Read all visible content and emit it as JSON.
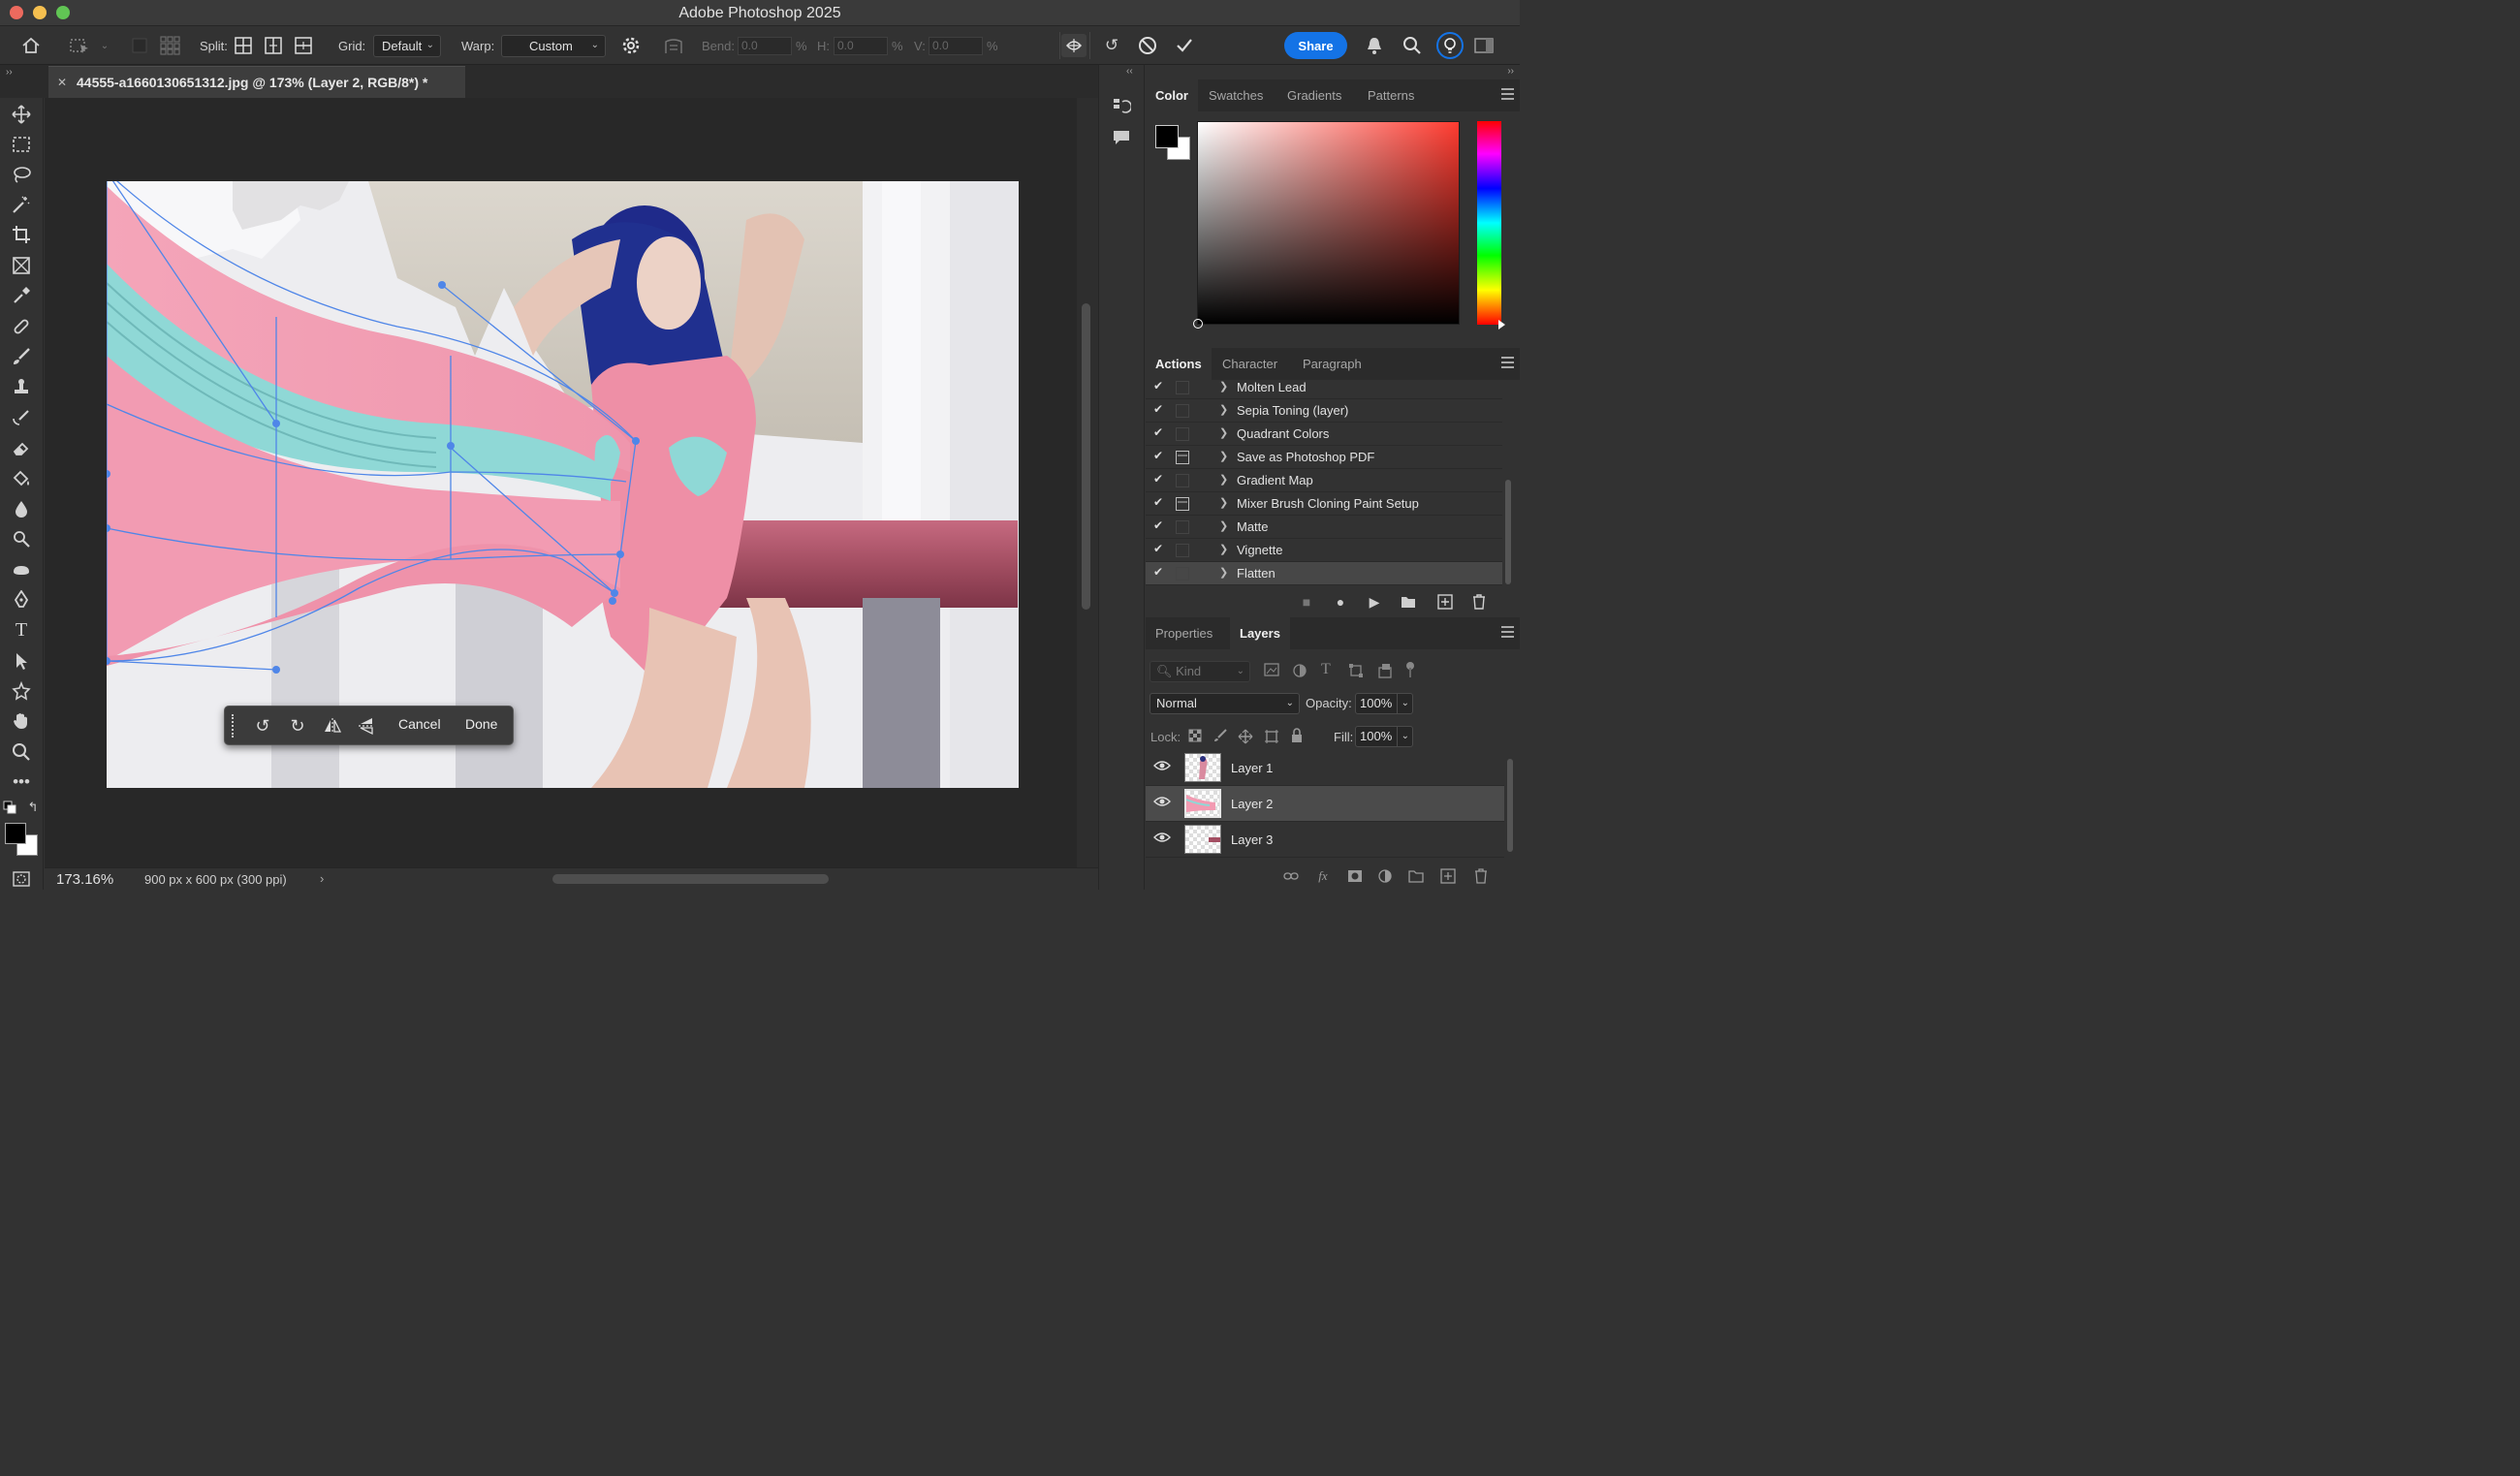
{
  "app": {
    "title": "Adobe Photoshop 2025"
  },
  "options_bar": {
    "split_label": "Split:",
    "grid_label": "Grid:",
    "grid_value": "Default",
    "warp_label": "Warp:",
    "warp_value": "Custom",
    "bend_label": "Bend:",
    "bend_value": "0.0",
    "h_label": "H:",
    "h_value": "0.0",
    "v_label": "V:",
    "v_value": "0.0",
    "percent": "%",
    "share_label": "Share"
  },
  "document": {
    "tab_title": "44555-a1660130651312.jpg @ 173% (Layer 2, RGB/8*) *",
    "zoom": "173.16%",
    "doc_info": "900 px x 600 px (300 ppi)"
  },
  "transform_bar": {
    "cancel_label": "Cancel",
    "done_label": "Done"
  },
  "color_panel": {
    "tabs": [
      "Color",
      "Swatches",
      "Gradients",
      "Patterns"
    ],
    "foreground": "#000000",
    "background": "#ffffff",
    "hue_color": "#ff3b30"
  },
  "actions_panel": {
    "tabs": [
      "Actions",
      "Character",
      "Paragraph"
    ],
    "items": [
      {
        "label": "Molten Lead"
      },
      {
        "label": "Sepia Toning (layer)"
      },
      {
        "label": "Quadrant Colors"
      },
      {
        "label": "Save as Photoshop PDF"
      },
      {
        "label": "Gradient Map"
      },
      {
        "label": "Mixer Brush Cloning Paint Setup"
      },
      {
        "label": "Matte"
      },
      {
        "label": "Vignette"
      },
      {
        "label": "Flatten"
      }
    ],
    "selected": "Flatten"
  },
  "layers_panel": {
    "tabs": [
      "Properties",
      "Layers"
    ],
    "kind_placeholder": "Kind",
    "blend_mode": "Normal",
    "opacity_label": "Opacity:",
    "opacity_value": "100%",
    "lock_label": "Lock:",
    "fill_label": "Fill:",
    "fill_value": "100%",
    "layers": [
      {
        "name": "Layer 1"
      },
      {
        "name": "Layer 2"
      },
      {
        "name": "Layer 3"
      }
    ],
    "selected": "Layer 2"
  },
  "colors": {
    "accent": "#1473e6",
    "warp_handle": "#4f86e8",
    "fabric_pink": "#ef9cb2",
    "fabric_teal": "#8fd8d6",
    "swimsuit": "#ee8fa6",
    "rod": "#b9596e"
  }
}
